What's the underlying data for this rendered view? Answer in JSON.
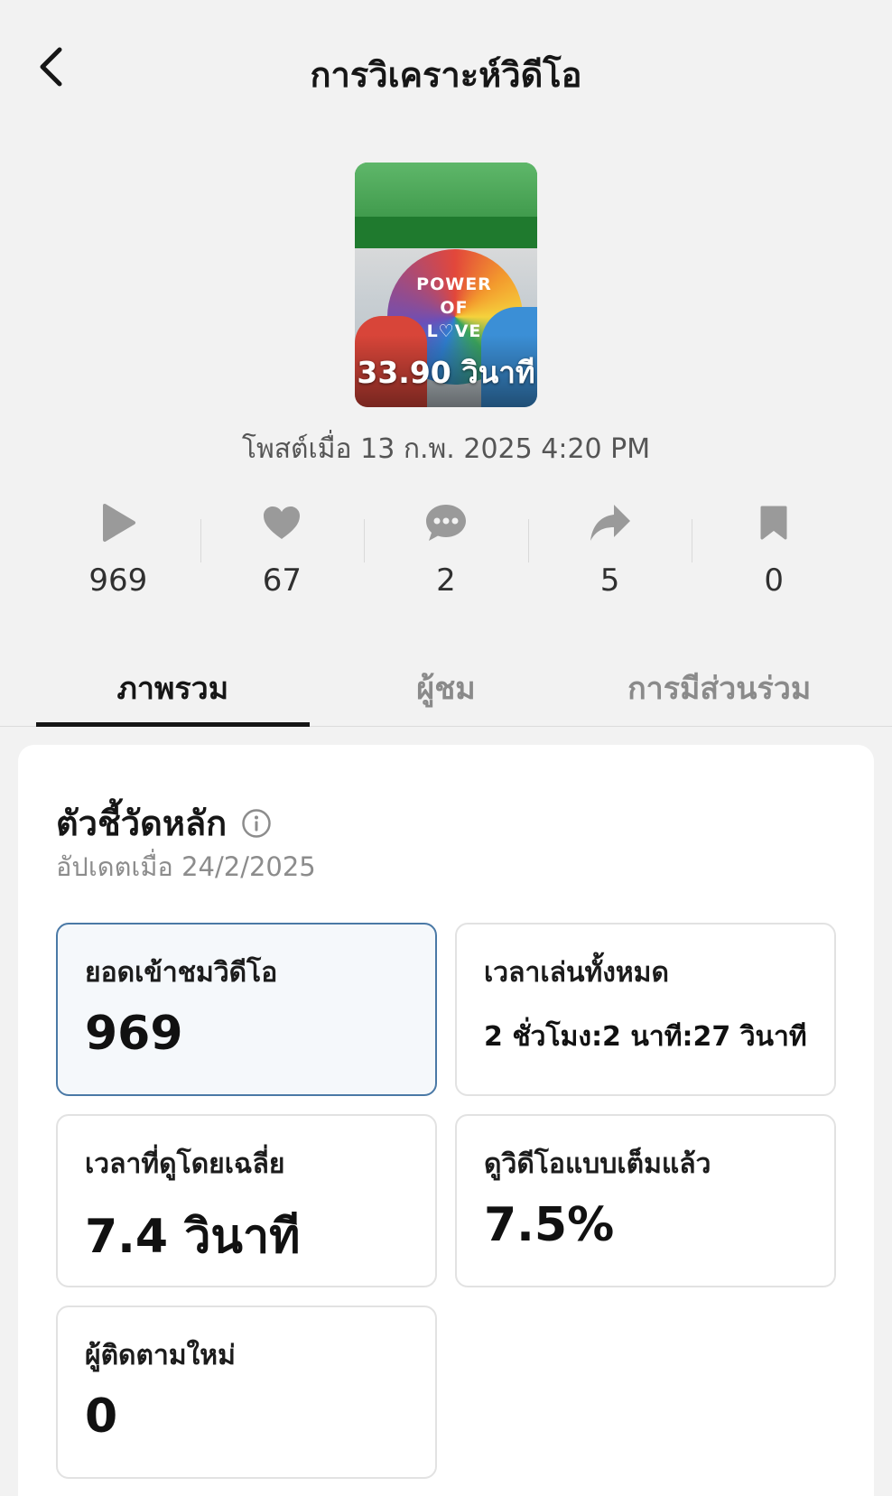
{
  "header": {
    "title": "การวิเคราะห์วิดีโอ",
    "back_icon": "chevron-left-icon"
  },
  "video": {
    "duration": "33.90 วินาที",
    "sign_text": "POWER OF\nL♡VE",
    "posted": "โพสต์เมื่อ 13 ก.พ. 2025 4:20 PM"
  },
  "stats": [
    {
      "icon": "play-icon",
      "value": "969"
    },
    {
      "icon": "heart-icon",
      "value": "67"
    },
    {
      "icon": "comment-icon",
      "value": "2"
    },
    {
      "icon": "share-icon",
      "value": "5"
    },
    {
      "icon": "bookmark-icon",
      "value": "0"
    }
  ],
  "tabs": [
    {
      "label": "ภาพรวม",
      "active": true
    },
    {
      "label": "ผู้ชม",
      "active": false
    },
    {
      "label": "การมีส่วนร่วม",
      "active": false
    }
  ],
  "key_metrics": {
    "title": "ตัวชี้วัดหลัก",
    "updated": "อัปเดตเมื่อ 24/2/2025",
    "items": [
      {
        "label": "ยอดเข้าชมวิดีโอ",
        "value": "969"
      },
      {
        "label": "เวลาเล่นทั้งหมด",
        "value": "2 ชั่วโมง:2 นาที:27 วินาที"
      },
      {
        "label": "เวลาที่ดูโดยเฉลี่ย",
        "value": "7.4 วินาที"
      },
      {
        "label": "ดูวิดีโอแบบเต็มแล้ว",
        "value": "7.5%"
      },
      {
        "label": "ผู้ติดตามใหม่",
        "value": "0"
      }
    ]
  },
  "colors": {
    "background": "#f2f2f2",
    "card": "#ffffff",
    "highlight_border": "#4a79a6",
    "icon_gray": "#9a9a9a",
    "text_primary": "#161616",
    "text_secondary": "#8c8c8c"
  }
}
